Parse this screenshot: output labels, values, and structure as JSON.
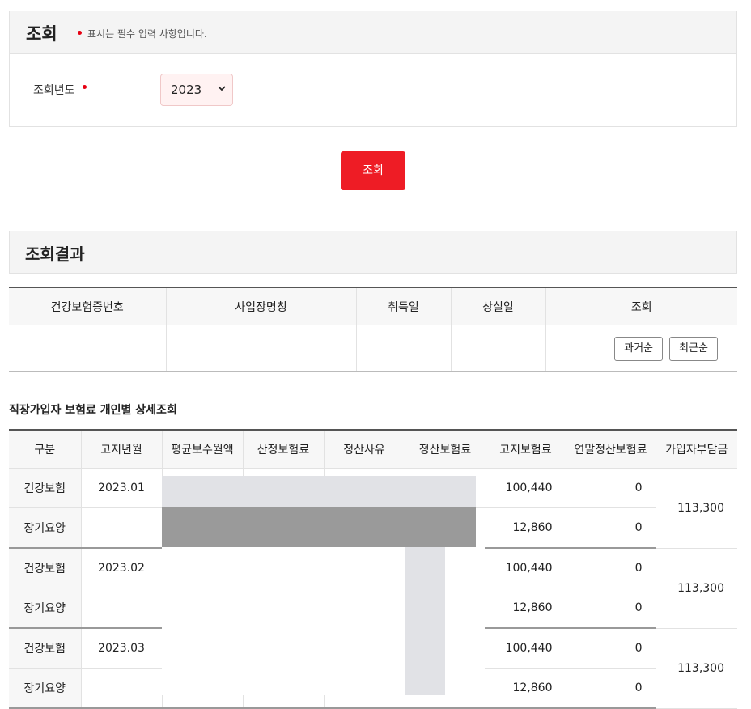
{
  "search": {
    "title": "조회",
    "required_note": "표시는 필수 입력 사항입니다.",
    "year_label": "조회년도",
    "year_value": "2023",
    "button": "조회"
  },
  "results": {
    "title": "조회결과",
    "columns": [
      "건강보험증번호",
      "사업장명칭",
      "취득일",
      "상실일",
      "조회"
    ],
    "sort_old": "과거순",
    "sort_new": "최근순"
  },
  "detail": {
    "title": "직장가입자 보험료 개인별 상세조회",
    "columns": [
      "구분",
      "고지년월",
      "평균보수월액",
      "산정보험료",
      "정산사유",
      "정산보험료",
      "고지보험료",
      "연말정산보험료",
      "가입자부담금"
    ],
    "rows": [
      {
        "month": "2023.01",
        "health_label": "건강보험",
        "health_notice": "100,440",
        "health_yearend": "0",
        "ltc_label": "장기요양",
        "ltc_notice": "12,860",
        "ltc_yearend": "0",
        "total": "113,300"
      },
      {
        "month": "2023.02",
        "health_label": "건강보험",
        "health_notice": "100,440",
        "health_yearend": "0",
        "ltc_label": "장기요양",
        "ltc_notice": "12,860",
        "ltc_yearend": "0",
        "total": "113,300"
      },
      {
        "month": "2023.03",
        "health_label": "건강보험",
        "health_notice": "100,440",
        "health_yearend": "0",
        "ltc_label": "장기요양",
        "ltc_notice": "12,860",
        "ltc_yearend": "0",
        "total": "113,300"
      }
    ]
  },
  "colors": {
    "accent_red": "#ee1c25",
    "required_dot": "#e60012",
    "mask_light": "#e1e2e6",
    "mask_dark": "#9a9a9a"
  },
  "icons": [
    "chevron-down-icon"
  ]
}
